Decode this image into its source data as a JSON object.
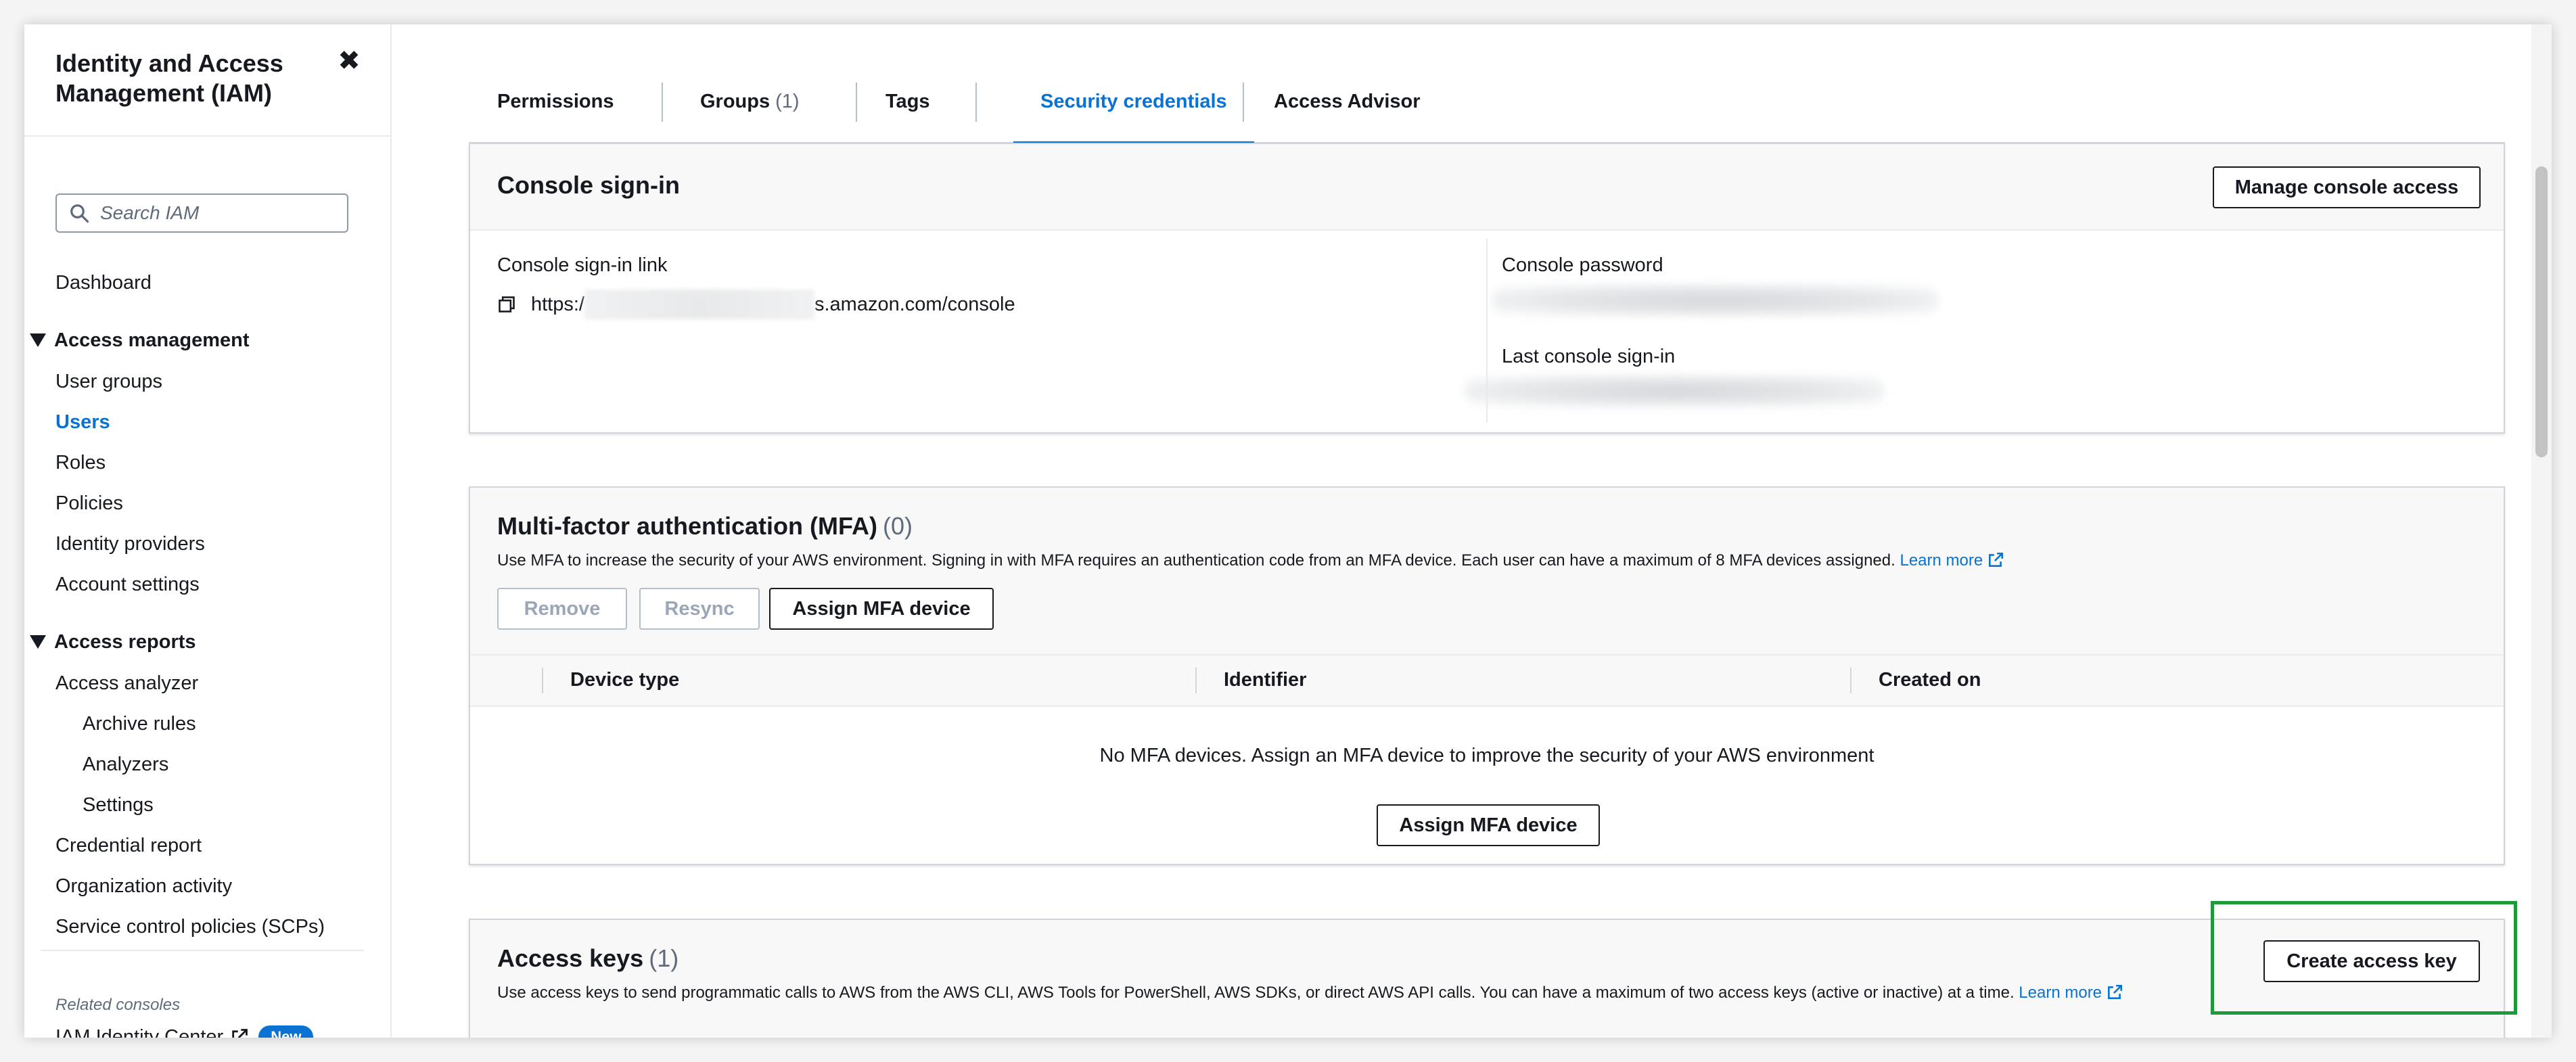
{
  "sidebar": {
    "title": "Identity and Access Management (IAM)",
    "close_icon": "close-icon",
    "search": {
      "placeholder": "Search IAM",
      "value": ""
    },
    "dashboard": "Dashboard",
    "access_management": {
      "heading": "Access management",
      "items": [
        "User groups",
        "Users",
        "Roles",
        "Policies",
        "Identity providers",
        "Account settings"
      ],
      "active": "Users"
    },
    "access_reports": {
      "heading": "Access reports",
      "items": [
        "Access analyzer",
        "Archive rules",
        "Analyzers",
        "Settings",
        "Credential report",
        "Organization activity",
        "Service control policies (SCPs)"
      ]
    },
    "related_consoles_label": "Related consoles",
    "related_item": "IAM Identity Center",
    "new_badge": "New"
  },
  "tabs": [
    {
      "label": "Permissions",
      "count": ""
    },
    {
      "label": "Groups",
      "count": "(1)"
    },
    {
      "label": "Tags",
      "count": ""
    },
    {
      "label": "Security credentials",
      "count": ""
    },
    {
      "label": "Access Advisor",
      "count": ""
    }
  ],
  "active_tab": "Security credentials",
  "console_signin": {
    "title": "Console sign-in",
    "manage_button": "Manage console access",
    "link_label": "Console sign-in link",
    "link_prefix": "https:/",
    "link_suffix": "s.amazon.com/console",
    "password_label": "Console password",
    "last_signin_label": "Last console sign-in"
  },
  "mfa": {
    "title": "Multi-factor authentication (MFA)",
    "count": "(0)",
    "description": "Use MFA to increase the security of your AWS environment. Signing in with MFA requires an authentication code from an MFA device. Each user can have a maximum of 8 MFA devices assigned.",
    "learn_more": "Learn more",
    "buttons": {
      "remove": "Remove",
      "resync": "Resync",
      "assign": "Assign MFA device"
    },
    "columns": [
      "Device type",
      "Identifier",
      "Created on"
    ],
    "empty_text": "No MFA devices. Assign an MFA device to improve the security of your AWS environment",
    "empty_button": "Assign MFA device"
  },
  "access_keys": {
    "title": "Access keys",
    "count": "(1)",
    "description": "Use access keys to send programmatic calls to AWS from the AWS CLI, AWS Tools for PowerShell, AWS SDKs, or direct AWS API calls. You can have a maximum of two access keys (active or inactive) at a time.",
    "learn_more": "Learn more",
    "create_button": "Create access key"
  },
  "colors": {
    "accent": "#0972d3",
    "highlight": "#1e9a3a",
    "text": "#16191f",
    "muted": "#5f6b7a"
  }
}
